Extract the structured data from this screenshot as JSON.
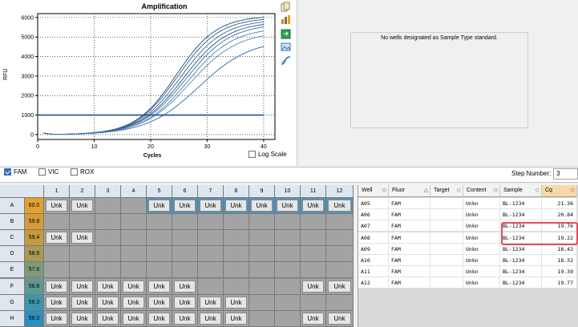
{
  "chart": {
    "title": "Amplification",
    "ylabel": "RFU",
    "xlabel": "Cycles",
    "log_scale_label": "Log Scale",
    "log_scale_checked": false
  },
  "chart_data": {
    "type": "line",
    "title": "Amplification",
    "xlabel": "Cycles",
    "ylabel": "RFU",
    "xlim": [
      0,
      42
    ],
    "ylim": [
      -250,
      6200
    ],
    "x_ticks": [
      "0",
      "10",
      "20",
      "30",
      "40"
    ],
    "y_ticks": [
      "0",
      "1000",
      "2000",
      "3000",
      "4000",
      "5000",
      "6000"
    ],
    "grid": true,
    "threshold": 1000,
    "series": [
      {
        "params": [
          6100,
          24.5,
          3.6
        ]
      },
      {
        "params": [
          6000,
          24.8,
          3.7
        ]
      },
      {
        "params": [
          5900,
          25.3,
          3.8
        ]
      },
      {
        "params": [
          5800,
          25.8,
          3.9
        ]
      },
      {
        "params": [
          5700,
          26.2,
          4.0
        ]
      },
      {
        "params": [
          5500,
          26.6,
          4.0
        ]
      },
      {
        "params": [
          5300,
          27.0,
          4.2
        ]
      },
      {
        "params": [
          4900,
          28.5,
          4.6
        ]
      }
    ]
  },
  "filters": [
    {
      "label": "FAM",
      "checked": true
    },
    {
      "label": "VIC",
      "checked": false
    },
    {
      "label": "ROX",
      "checked": false
    }
  ],
  "step": {
    "label": "Step Number:",
    "value": "3"
  },
  "standards_message": "No wells designated as Sample Type standard.",
  "plate": {
    "columns": [
      "1",
      "2",
      "3",
      "4",
      "5",
      "6",
      "7",
      "8",
      "9",
      "10",
      "11",
      "12"
    ],
    "rows": [
      {
        "label": "A",
        "temp": "60.0",
        "temp_color": "#e2a12e",
        "wells": [
          "Unk",
          "Unk",
          "",
          "",
          "Unk*",
          "Unk*",
          "Unk*",
          "Unk*",
          "Unk*",
          "Unk*",
          "Unk*",
          "Unk*"
        ]
      },
      {
        "label": "B",
        "temp": "59.8",
        "temp_color": "#d69a38",
        "wells": [
          "",
          "",
          "",
          "",
          "",
          "",
          "",
          "",
          "",
          "",
          "",
          ""
        ]
      },
      {
        "label": "C",
        "temp": "59.4",
        "temp_color": "#c7993f",
        "wells": [
          "Unk",
          "Unk",
          "",
          "",
          "",
          "",
          "",
          "",
          "",
          "",
          "",
          ""
        ]
      },
      {
        "label": "D",
        "temp": "58.6",
        "temp_color": "#a89a57",
        "wells": [
          "",
          "",
          "",
          "",
          "",
          "",
          "",
          "",
          "",
          "",
          "",
          ""
        ]
      },
      {
        "label": "E",
        "temp": "57.6",
        "temp_color": "#7f9a77",
        "wells": [
          "",
          "",
          "",
          "",
          "",
          "",
          "",
          "",
          "",
          "",
          "",
          ""
        ]
      },
      {
        "label": "F",
        "temp": "56.8",
        "temp_color": "#5f9890",
        "wells": [
          "Unk",
          "Unk",
          "Unk",
          "Unk",
          "Unk",
          "Unk",
          "",
          "",
          "",
          "",
          "Unk",
          "Unk"
        ]
      },
      {
        "label": "G",
        "temp": "56.3",
        "temp_color": "#3f95ab",
        "wells": [
          "Unk",
          "Unk",
          "Unk",
          "Unk",
          "Unk",
          "Unk",
          "Unk",
          "Unk",
          "",
          "",
          "",
          ""
        ]
      },
      {
        "label": "H",
        "temp": "56.0",
        "temp_color": "#2b8fc0",
        "wells": [
          "Unk",
          "Unk",
          "Unk",
          "Unk",
          "Unk",
          "Unk",
          "Unk",
          "Unk",
          "",
          "",
          "Unk",
          "Unk"
        ]
      }
    ]
  },
  "results": {
    "headers": [
      "Well",
      "Fluor",
      "Target",
      "Content",
      "Sample",
      "Cq"
    ],
    "rows": [
      [
        "A05",
        "FAM",
        "",
        "Unkn",
        "BL-1234",
        "21.36"
      ],
      [
        "A06",
        "FAM",
        "",
        "Unkn",
        "BL-1234",
        "20.84"
      ],
      [
        "A07",
        "FAM",
        "",
        "Unkn",
        "BL-1234",
        "19.76"
      ],
      [
        "A08",
        "FAM",
        "",
        "Unkn",
        "BL-1234",
        "19.22"
      ],
      [
        "A09",
        "FAM",
        "",
        "Unkn",
        "BL-1234",
        "18.42"
      ],
      [
        "A10",
        "FAM",
        "",
        "Unkn",
        "BL-1234",
        "18.32"
      ],
      [
        "A11",
        "FAM",
        "",
        "Unkn",
        "BL-1234",
        "19.39"
      ],
      [
        "A12",
        "FAM",
        "",
        "Unkn",
        "BL-1234",
        "19.77"
      ]
    ]
  },
  "toolbar_icons": [
    "copy-icon",
    "chart-settings-icon",
    "export-icon",
    "image-export-icon",
    "curve-icon"
  ]
}
